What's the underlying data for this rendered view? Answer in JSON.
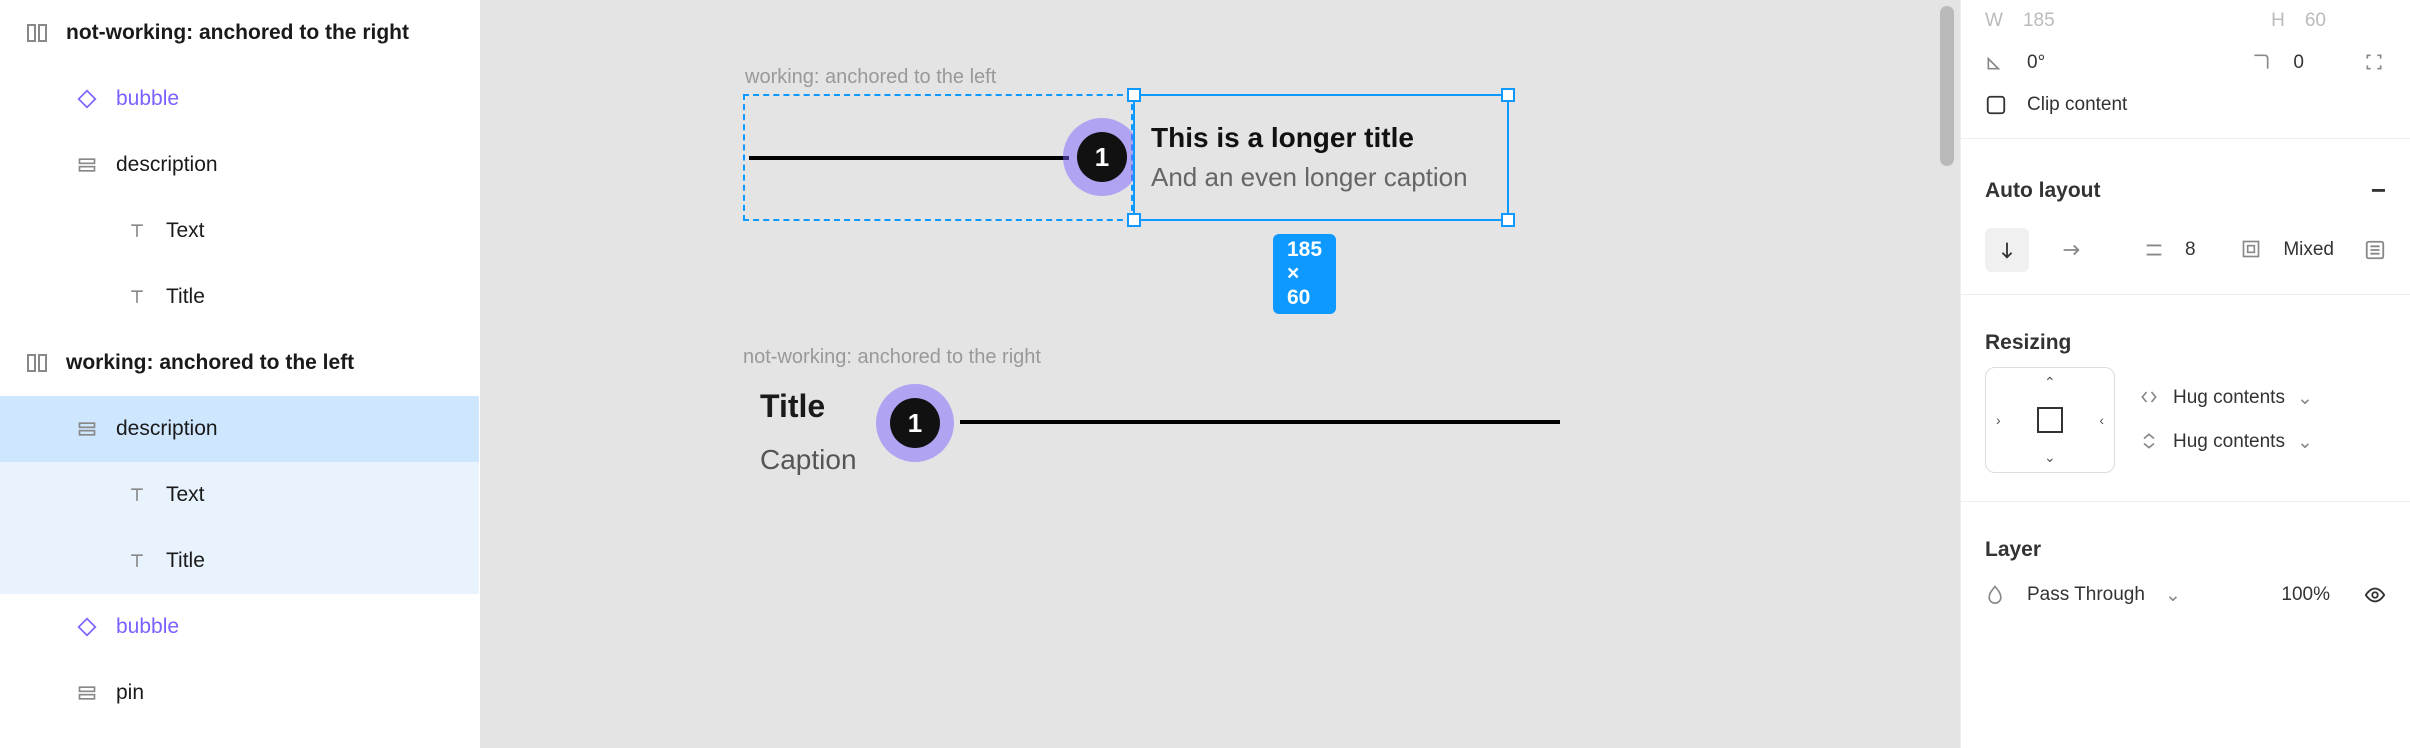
{
  "layers": {
    "frame_not_working": "not-working: anchored to the right",
    "frame_working": "working: anchored to the left",
    "bubble": "bubble",
    "description": "description",
    "text": "Text",
    "title": "Title",
    "pin": "pin"
  },
  "canvas": {
    "working_label": "working: anchored to the left",
    "not_working_label": "not-working: anchored to the right",
    "content1": {
      "title": "This is a longer title",
      "caption": "And an even longer caption"
    },
    "content2": {
      "title": "Title",
      "caption": "Caption"
    },
    "bubble_number": "1",
    "selection_dims": "185 × 60"
  },
  "design": {
    "w_label": "W",
    "w_value": "185",
    "h_label": "H",
    "h_value": "60",
    "rotation_value": "0°",
    "radius_value": "0",
    "clip_content": "Clip content",
    "auto_layout": "Auto layout",
    "gap_value": "8",
    "padding_value": "Mixed",
    "resizing": "Resizing",
    "hug_h": "Hug contents",
    "hug_v": "Hug contents",
    "layer": "Layer",
    "blend": "Pass Through",
    "opacity": "100%"
  }
}
